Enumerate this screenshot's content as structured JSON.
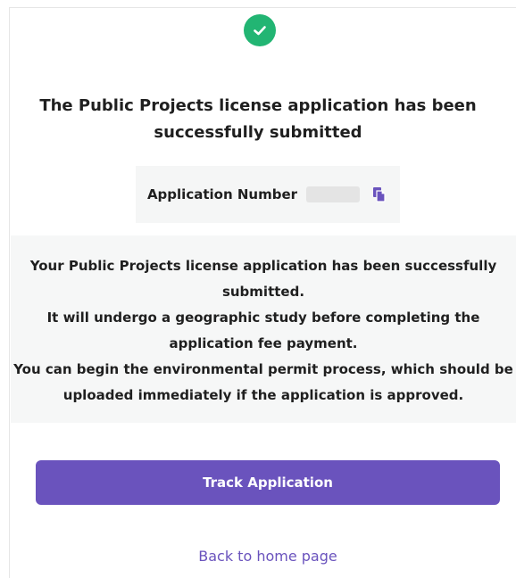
{
  "status": {
    "icon": "check-circle-icon",
    "color": "#22b573"
  },
  "title": {
    "line1": "The Public Projects license application has been",
    "line2": "successfully submitted"
  },
  "application_number": {
    "label": "Application Number",
    "value": "",
    "copy_icon": "copy-icon"
  },
  "message": {
    "lines": [
      "Your Public Projects license application has been successfully",
      "submitted.",
      "It will undergo a geographic study before completing the",
      "application fee payment.",
      "You can begin the environmental permit process, which should be",
      "uploaded immediately if the application is approved."
    ]
  },
  "actions": {
    "track_label": "Track Application",
    "home_label": "Back to home page"
  },
  "colors": {
    "accent": "#6a53bd",
    "success": "#22b573",
    "panel": "#f6f7f7"
  }
}
